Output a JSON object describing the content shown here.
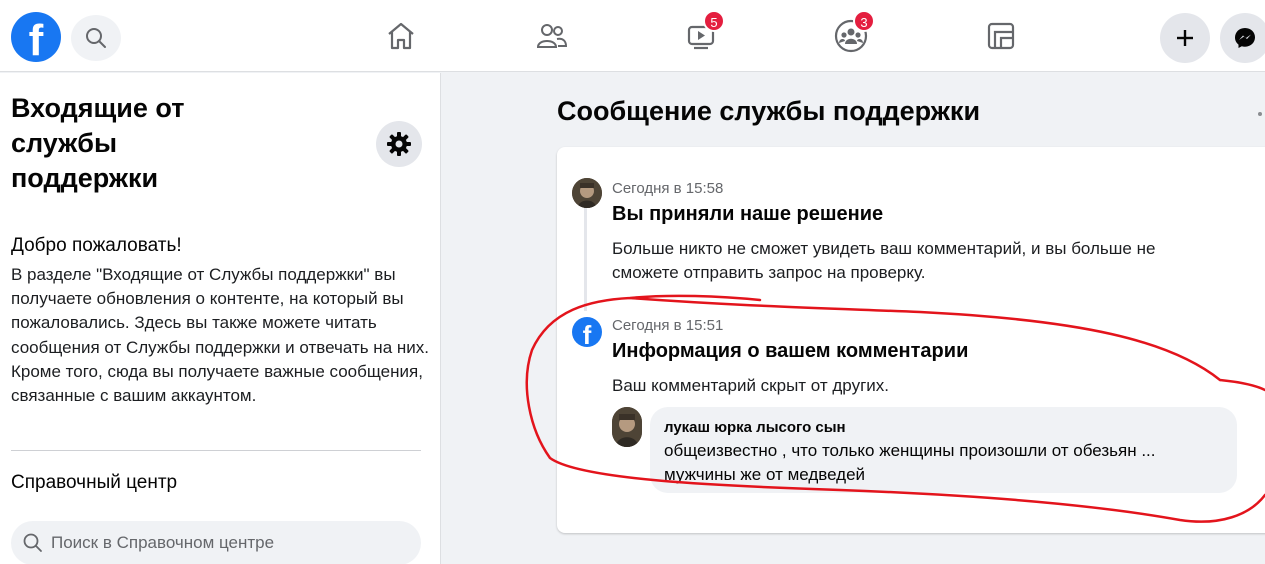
{
  "topbar": {
    "logo_letter": "f",
    "nav": [
      {
        "icon": "home-icon"
      },
      {
        "icon": "friends-icon"
      },
      {
        "icon": "watch-icon",
        "badge": "5"
      },
      {
        "icon": "groups-icon",
        "badge": "3"
      },
      {
        "icon": "gaming-icon"
      }
    ],
    "badge_color": "#e41e3f",
    "brand_color": "#1877f2"
  },
  "sidebar": {
    "title": "Входящие от службы поддержки",
    "welcome_title": "Добро пожаловать!",
    "welcome_text": "В разделе \"Входящие от Службы поддержки\" вы получаете обновления о контенте, на который вы пожаловались. Здесь вы также можете читать сообщения от Службы поддержки и отвечать на них. Кроме того, сюда вы получаете важные сообщения, связанные с вашим аккаунтом.",
    "help_title": "Справочный центр",
    "help_search_placeholder": "Поиск в Справочном центре"
  },
  "main": {
    "title": "Сообщение службы поддержки",
    "messages": [
      {
        "time": "Сегодня в 15:58",
        "title": "Вы приняли наше решение",
        "body": "Больше никто не сможет увидеть ваш комментарий, и вы больше не сможете отправить запрос на проверку."
      },
      {
        "time": "Сегодня в 15:51",
        "title": "Информация о вашем комментарии",
        "body": "Ваш комментарий скрыт от других."
      }
    ],
    "comment": {
      "author": "лукаш юрка лысого сын",
      "text": "общеизвестно , что только женщины произошли от обезьян ... мужчины же от медведей"
    }
  },
  "annotation_color": "#e3141c"
}
